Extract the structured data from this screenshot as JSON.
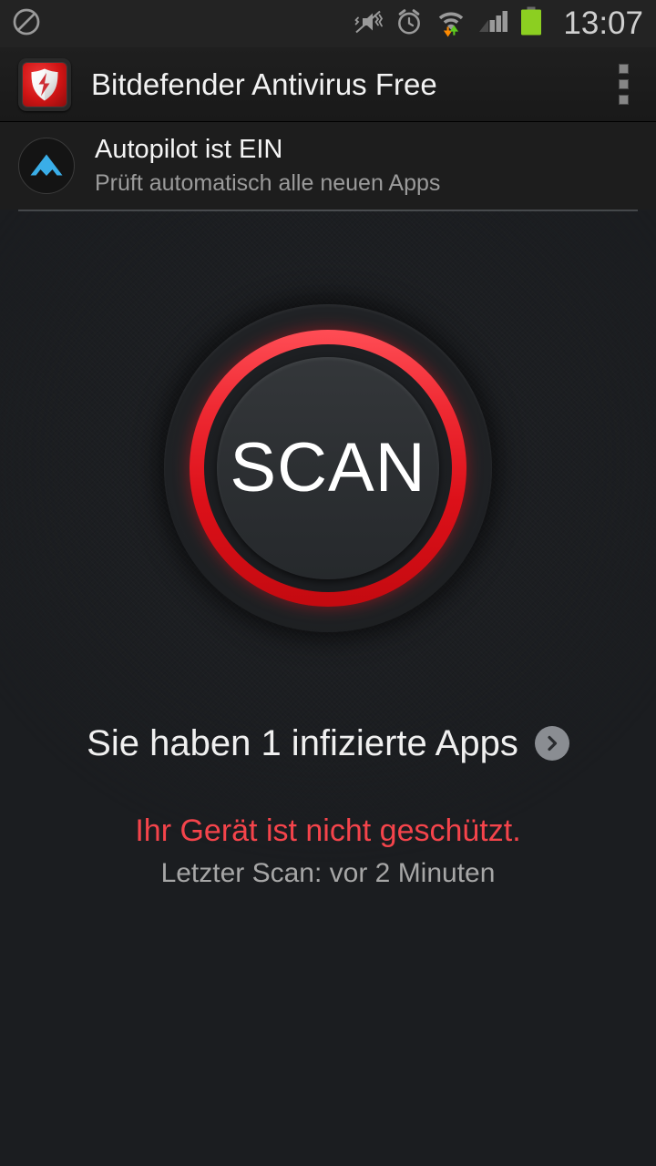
{
  "status_bar": {
    "clock": "13:07",
    "icons": [
      {
        "name": "do-not-disturb-icon",
        "glyph": "no-entry"
      },
      {
        "name": "vibrate-off-icon",
        "glyph": "mute-vibrate"
      },
      {
        "name": "alarm-clock-icon",
        "glyph": "alarm"
      },
      {
        "name": "wifi-data-transfer-icon",
        "glyph": "wifi-arrows"
      },
      {
        "name": "cellular-signal-icon",
        "glyph": "signal-bars"
      },
      {
        "name": "battery-icon",
        "glyph": "battery-full"
      }
    ],
    "battery_color": "#8ccf21",
    "data_down_color": "#ff8a00",
    "data_up_color": "#5fcb1f"
  },
  "title_bar": {
    "app_name": "Bitdefender Antivirus Free",
    "app_icon_name": "bitdefender-shield-icon",
    "overflow_label": "overflow-menu"
  },
  "autopilot": {
    "title": "Autopilot ist EIN",
    "subtitle": "Prüft automatisch alle neuen Apps",
    "icon_name": "autopilot-mountain-icon",
    "icon_color": "#3aaee8"
  },
  "scan": {
    "label": "SCAN",
    "ring_color_top": "#ff4d55",
    "ring_color_bottom": "#c40a10"
  },
  "results": {
    "infected_text": "Sie haben 1 infizierte Apps",
    "infected_count": 1,
    "chevron_name": "chevron-right-icon",
    "unprotected_text": "Ihr Gerät ist nicht geschützt.",
    "unprotected_color": "#f5444b",
    "last_scan_text": "Letzter Scan: vor 2 Minuten"
  }
}
